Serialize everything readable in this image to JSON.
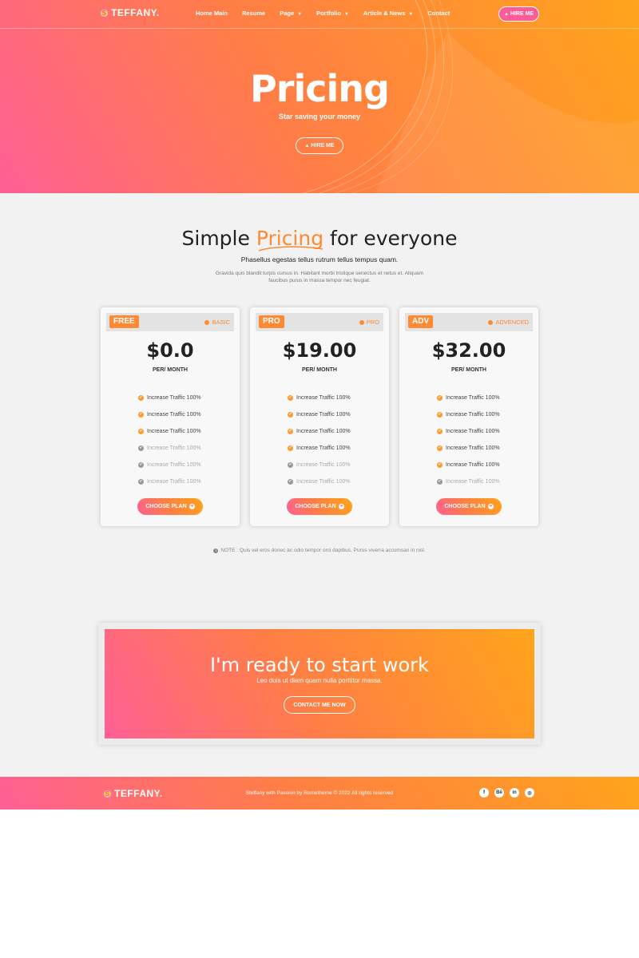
{
  "brand": {
    "logo_letter": "S",
    "logo_text": "TEFFANY."
  },
  "nav": {
    "links": [
      {
        "label": "Home Main",
        "has_caret": false
      },
      {
        "label": "Resume",
        "has_caret": false
      },
      {
        "label": "Page",
        "has_caret": true
      },
      {
        "label": "Portfolio",
        "has_caret": true
      },
      {
        "label": "Article & News",
        "has_caret": true
      },
      {
        "label": "Contact",
        "has_caret": false
      }
    ],
    "hire_label": "HIRE ME",
    "hire_icon": "bell-icon"
  },
  "hero": {
    "title": "Pricing",
    "subtitle": "Star saving your money",
    "button_label": "HIRE ME"
  },
  "pricing": {
    "title_before": "Simple ",
    "title_highlight": "Pricing",
    "title_after": " for everyone",
    "lead": "Phasellus egestas tellus rutrum tellus tempus quam.",
    "description": "Gravida quis blandit turpis cursus in. Habitant morbi tristique senectus et netus et. Aliquam faucibus purus in massa tempor nec feugiat.",
    "plans": [
      {
        "tag": "FREE",
        "type": "BASIC",
        "price": "$0.0",
        "period": "PER/ MONTH",
        "features": [
          {
            "label": "Increase Traffic 100%",
            "enabled": true
          },
          {
            "label": "Increase Traffic 100%",
            "enabled": true
          },
          {
            "label": "Increase Traffic 100%",
            "enabled": true
          },
          {
            "label": "Increase Traffic 100%",
            "enabled": false
          },
          {
            "label": "Increase Traffic 100%",
            "enabled": false
          },
          {
            "label": "Increase Traffic 100%",
            "enabled": false
          }
        ],
        "button": "CHOOSE PLAN"
      },
      {
        "tag": "PRO",
        "type": "PRO",
        "price": "$19.00",
        "period": "PER/ MONTH",
        "features": [
          {
            "label": "Increase Traffic 100%",
            "enabled": true
          },
          {
            "label": "Increase Traffic 100%",
            "enabled": true
          },
          {
            "label": "Increase Traffic 100%",
            "enabled": true
          },
          {
            "label": "Increase Traffic 100%",
            "enabled": true
          },
          {
            "label": "Increase Traffic 100%",
            "enabled": false
          },
          {
            "label": "Increase Traffic 100%",
            "enabled": false
          }
        ],
        "button": "CHOOSE PLAN"
      },
      {
        "tag": "ADV",
        "type": "ADVENCED",
        "price": "$32.00",
        "period": "PER/ MONTH",
        "features": [
          {
            "label": "Increase Traffic 100%",
            "enabled": true
          },
          {
            "label": "Increase Traffic 100%",
            "enabled": true
          },
          {
            "label": "Increase Traffic 100%",
            "enabled": true
          },
          {
            "label": "Increase Traffic 100%",
            "enabled": true
          },
          {
            "label": "Increase Traffic 100%",
            "enabled": true
          },
          {
            "label": "Increase Traffic 100%",
            "enabled": false
          }
        ],
        "button": "CHOOSE PLAN"
      }
    ],
    "note": "NOTE : Quis vel eros donec ac odio tempor orci dapibus. Purus viverra accumsan in nisl."
  },
  "cta": {
    "title": "I'm ready to start work",
    "subtitle": "Leo duis ut diam quam nulla porttitor massa.",
    "button_label": "CONTACT ME NOW"
  },
  "footer": {
    "copyright": "Steffany with Passion by Romethemе © 2022 All rights reserved",
    "socials": [
      {
        "icon": "facebook-icon",
        "glyph": "f"
      },
      {
        "icon": "behance-icon",
        "glyph": "Bē"
      },
      {
        "icon": "linkedin-icon",
        "glyph": "in"
      },
      {
        "icon": "instagram-icon",
        "glyph": "◎"
      }
    ]
  },
  "colors": {
    "accent": "#ff8a34",
    "gradient_start": "#ff5f95",
    "gradient_end": "#ffa41b",
    "section_bg": "#f2f2f2"
  }
}
